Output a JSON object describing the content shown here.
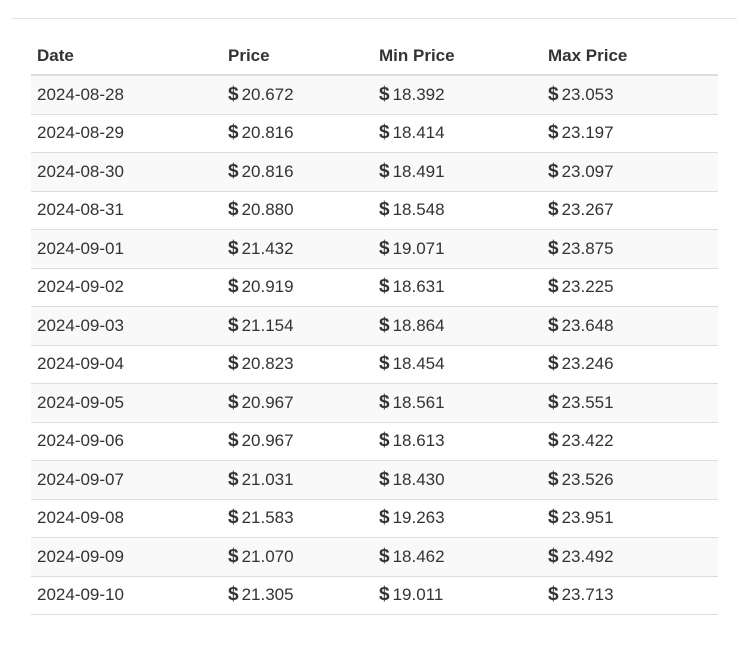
{
  "table": {
    "headers": [
      "Date",
      "Price",
      "Min Price",
      "Max Price"
    ],
    "currency_symbol": "$",
    "rows": [
      {
        "date": "2024-08-28",
        "price": "20.672",
        "min": "18.392",
        "max": "23.053"
      },
      {
        "date": "2024-08-29",
        "price": "20.816",
        "min": "18.414",
        "max": "23.197"
      },
      {
        "date": "2024-08-30",
        "price": "20.816",
        "min": "18.491",
        "max": "23.097"
      },
      {
        "date": "2024-08-31",
        "price": "20.880",
        "min": "18.548",
        "max": "23.267"
      },
      {
        "date": "2024-09-01",
        "price": "21.432",
        "min": "19.071",
        "max": "23.875"
      },
      {
        "date": "2024-09-02",
        "price": "20.919",
        "min": "18.631",
        "max": "23.225"
      },
      {
        "date": "2024-09-03",
        "price": "21.154",
        "min": "18.864",
        "max": "23.648"
      },
      {
        "date": "2024-09-04",
        "price": "20.823",
        "min": "18.454",
        "max": "23.246"
      },
      {
        "date": "2024-09-05",
        "price": "20.967",
        "min": "18.561",
        "max": "23.551"
      },
      {
        "date": "2024-09-06",
        "price": "20.967",
        "min": "18.613",
        "max": "23.422"
      },
      {
        "date": "2024-09-07",
        "price": "21.031",
        "min": "18.430",
        "max": "23.526"
      },
      {
        "date": "2024-09-08",
        "price": "21.583",
        "min": "19.263",
        "max": "23.951"
      },
      {
        "date": "2024-09-09",
        "price": "21.070",
        "min": "18.462",
        "max": "23.492"
      },
      {
        "date": "2024-09-10",
        "price": "21.305",
        "min": "19.011",
        "max": "23.713"
      }
    ]
  }
}
